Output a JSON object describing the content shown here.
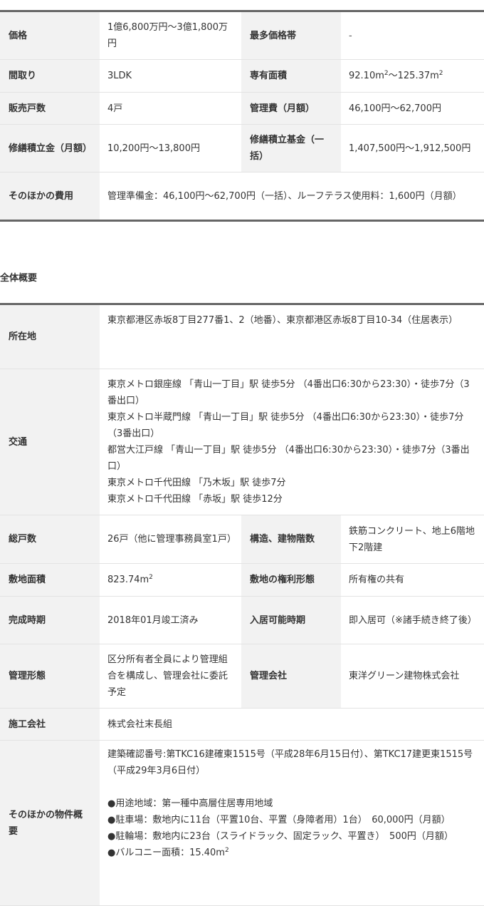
{
  "price_table": {
    "price_label": "価格",
    "price_value": "1億6,800万円～3億1,800万円",
    "most_price_band_label": "最多価格帯",
    "most_price_band_value": "-",
    "layout_label": "間取り",
    "layout_value": "3LDK",
    "area_label": "専有面積",
    "area_from": "92.10m",
    "area_sep": "～125.37m",
    "area_sup": "2",
    "units_label": "販売戸数",
    "units_value": "4戸",
    "mgmt_fee_label": "管理費（月額）",
    "mgmt_fee_value": "46,100円～62,700円",
    "repair_reserve_label": "修繕積立金（月額）",
    "repair_reserve_value": "10,200円～13,800円",
    "repair_fund_label": "修繕積立基金（一括）",
    "repair_fund_value": "1,407,500円～1,912,500円",
    "other_costs_label": "そのほかの費用",
    "other_costs_value": "管理準備金：46,100円～62,700円（一括）、ルーフテラス使用料：1,600円（月額）"
  },
  "overview": {
    "section_title": "全体概要",
    "location_label": "所在地",
    "location_value": "東京都港区赤坂8丁目277番1、2（地番）、東京都港区赤坂8丁目10-34（住居表示）",
    "transport_label": "交通",
    "transport_lines": [
      "東京メトロ銀座線 「青山一丁目」駅 徒歩5分 （4番出口6:30から23:30）・徒歩7分（3番出口）",
      "東京メトロ半蔵門線 「青山一丁目」駅 徒歩5分 （4番出口6:30から23:30）・徒歩7分（3番出口）",
      "都営大江戸線 「青山一丁目」駅 徒歩5分 （4番出口6:30から23:30）・徒歩7分（3番出口）",
      "東京メトロ千代田線 「乃木坂」駅 徒歩7分",
      "東京メトロ千代田線 「赤坂」駅 徒歩12分"
    ],
    "total_units_label": "総戸数",
    "total_units_value": "26戸（他に管理事務員室1戸）",
    "structure_label": "構造、建物階数",
    "structure_value": "鉄筋コンクリート、地上6階地下2階建",
    "site_area_label": "敷地面積",
    "site_area_value": "823.74m",
    "site_area_sup": "2",
    "site_rights_label": "敷地の権利形態",
    "site_rights_value": "所有権の共有",
    "completion_label": "完成時期",
    "completion_value": "2018年01月竣工済み",
    "move_in_label": "入居可能時期",
    "move_in_value": "即入居可（※諸手続き終了後）",
    "mgmt_form_label": "管理形態",
    "mgmt_form_value": "区分所有者全員により管理組合を構成し、管理会社に委託予定",
    "mgmt_company_label": "管理会社",
    "mgmt_company_value": "東洋グリーン建物株式会社",
    "builder_label": "施工会社",
    "builder_value": "株式会社末長組",
    "other_summary_label": "そのほかの物件概要",
    "other_summary_line1": "建築確認番号:第TKC16建確東1515号（平成28年6月15日付）、第TKC17建更東1515号（平成29年3月6日付）",
    "other_summary_line2": "●用途地域：第一種中高層住居専用地域",
    "other_summary_line3": "●駐車場：敷地内に11台（平置10台、平置（身障者用）1台）　60,000円（月額）",
    "other_summary_line4": "●駐輪場：敷地内に23台（スライドラック、固定ラック、平置き）　500円（月額）",
    "other_summary_line5": "●バルコニー面積：15.40m",
    "other_summary_line5_sup": "2"
  }
}
